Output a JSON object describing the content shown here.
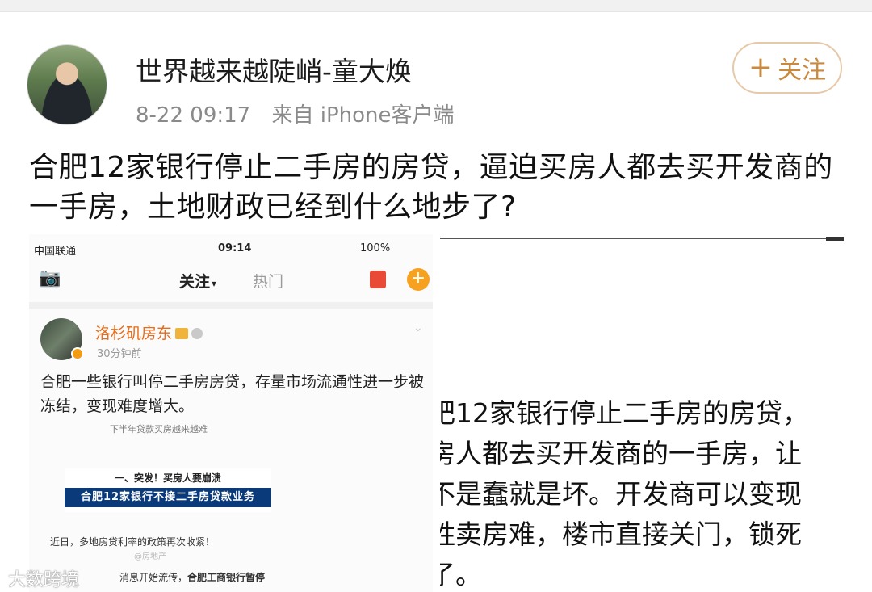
{
  "header": {
    "username": "世界越来越陡峭-童大焕",
    "time": "8-22 09:17",
    "source": "来自 iPhone客户端",
    "follow_label": "关注",
    "follow_plus": "+"
  },
  "post": {
    "text": "合肥12家银行停止二手房的房贷，逼迫买房人都去买开发商的一手房，土地财政已经到什么地步了?"
  },
  "left_screenshot": {
    "status_carrier": "中国联通",
    "status_time": "09:14",
    "status_battery": "100%",
    "nav_camera_icon": "📷",
    "tab_follow": "关注",
    "tab_hot": "热门",
    "plus_icon": "+",
    "poster_name": "洛杉矶房东",
    "poster_time": "30分钟前",
    "chevron": "⌄",
    "post_text": "合肥一些银行叫停二手房房贷，存量市场流通性进一步被冻结，变现难度增大。",
    "caption1": "下半年贷款买房越来越难",
    "card_heading": "一、突发！买房人要崩溃",
    "card_bar": "合肥12家银行不接二手房贷款业务",
    "caption2": "近日，多地房贷利率的政策再次收紧！",
    "caption3": "@房地产",
    "caption4_prefix": "消息开始流传，",
    "caption4_bold": "合肥工商银行暂停"
  },
  "right_screenshot": {
    "lines": [
      "肥12家银行停止二手房的房贷，",
      "房人都去买开发商的一手房，让",
      "不是蠢就是坏。开发商可以变现",
      "姓卖房难，楼市直接关门，锁死",
      "了。"
    ]
  },
  "watermark": "大数跨境"
}
